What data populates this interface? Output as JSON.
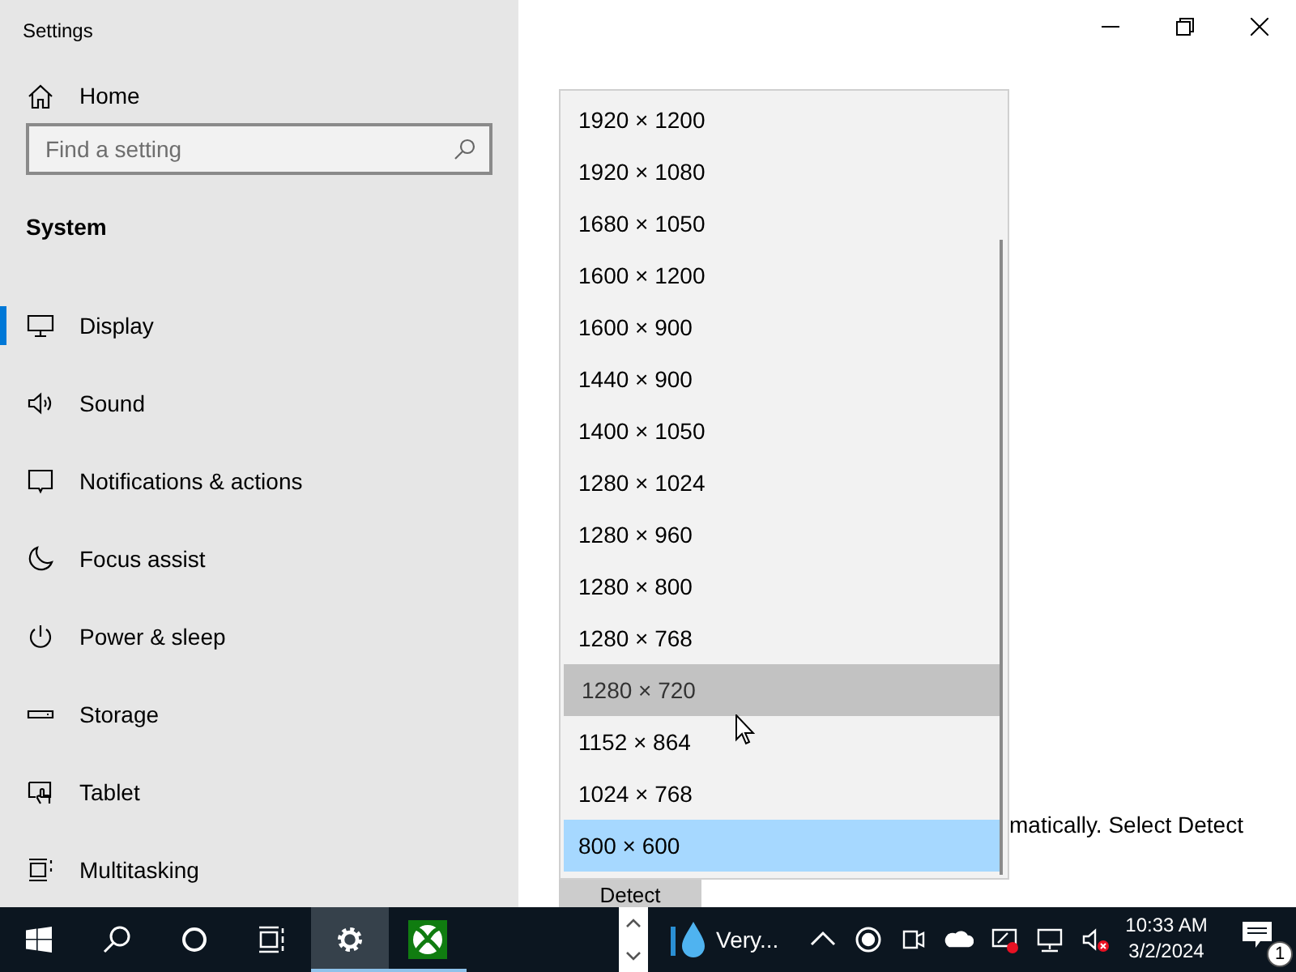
{
  "window": {
    "title": "Settings"
  },
  "sidebar": {
    "home": "Home",
    "search": {
      "placeholder": "Find a setting"
    },
    "section": "System",
    "items": [
      {
        "label": "Display",
        "selected": true
      },
      {
        "label": "Sound",
        "selected": false
      },
      {
        "label": "Notifications & actions",
        "selected": false
      },
      {
        "label": "Focus assist",
        "selected": false
      },
      {
        "label": "Power & sleep",
        "selected": false
      },
      {
        "label": "Storage",
        "selected": false
      },
      {
        "label": "Tablet",
        "selected": false
      },
      {
        "label": "Multitasking",
        "selected": false
      }
    ]
  },
  "content": {
    "text": "matically. Select Detect",
    "button": "Detect"
  },
  "resolution_list": [
    {
      "label": "1920 × 1200",
      "selected": false,
      "hovered": false
    },
    {
      "label": "1920 × 1080",
      "selected": false,
      "hovered": false
    },
    {
      "label": "1680 × 1050",
      "selected": false,
      "hovered": false
    },
    {
      "label": "1600 × 1200",
      "selected": false,
      "hovered": false
    },
    {
      "label": "1600 × 900",
      "selected": false,
      "hovered": false
    },
    {
      "label": "1440 × 900",
      "selected": false,
      "hovered": false
    },
    {
      "label": "1400 × 1050",
      "selected": false,
      "hovered": false
    },
    {
      "label": "1280 × 1024",
      "selected": false,
      "hovered": false
    },
    {
      "label": "1280 × 960",
      "selected": false,
      "hovered": false
    },
    {
      "label": "1280 × 800",
      "selected": false,
      "hovered": false
    },
    {
      "label": "1280 × 768",
      "selected": false,
      "hovered": false
    },
    {
      "label": "1280 × 720",
      "selected": false,
      "hovered": true
    },
    {
      "label": "1152 × 864",
      "selected": false,
      "hovered": false
    },
    {
      "label": "1024 × 768",
      "selected": false,
      "hovered": false
    },
    {
      "label": "800 × 600",
      "selected": true,
      "hovered": false
    }
  ],
  "taskbar": {
    "apps": [
      {
        "selected": true,
        "running": true
      },
      {
        "selected": false,
        "running": true
      }
    ],
    "app_label": "Very...",
    "time": "10:33 AM",
    "date": "3/2/2024",
    "notification_count": "1"
  }
}
